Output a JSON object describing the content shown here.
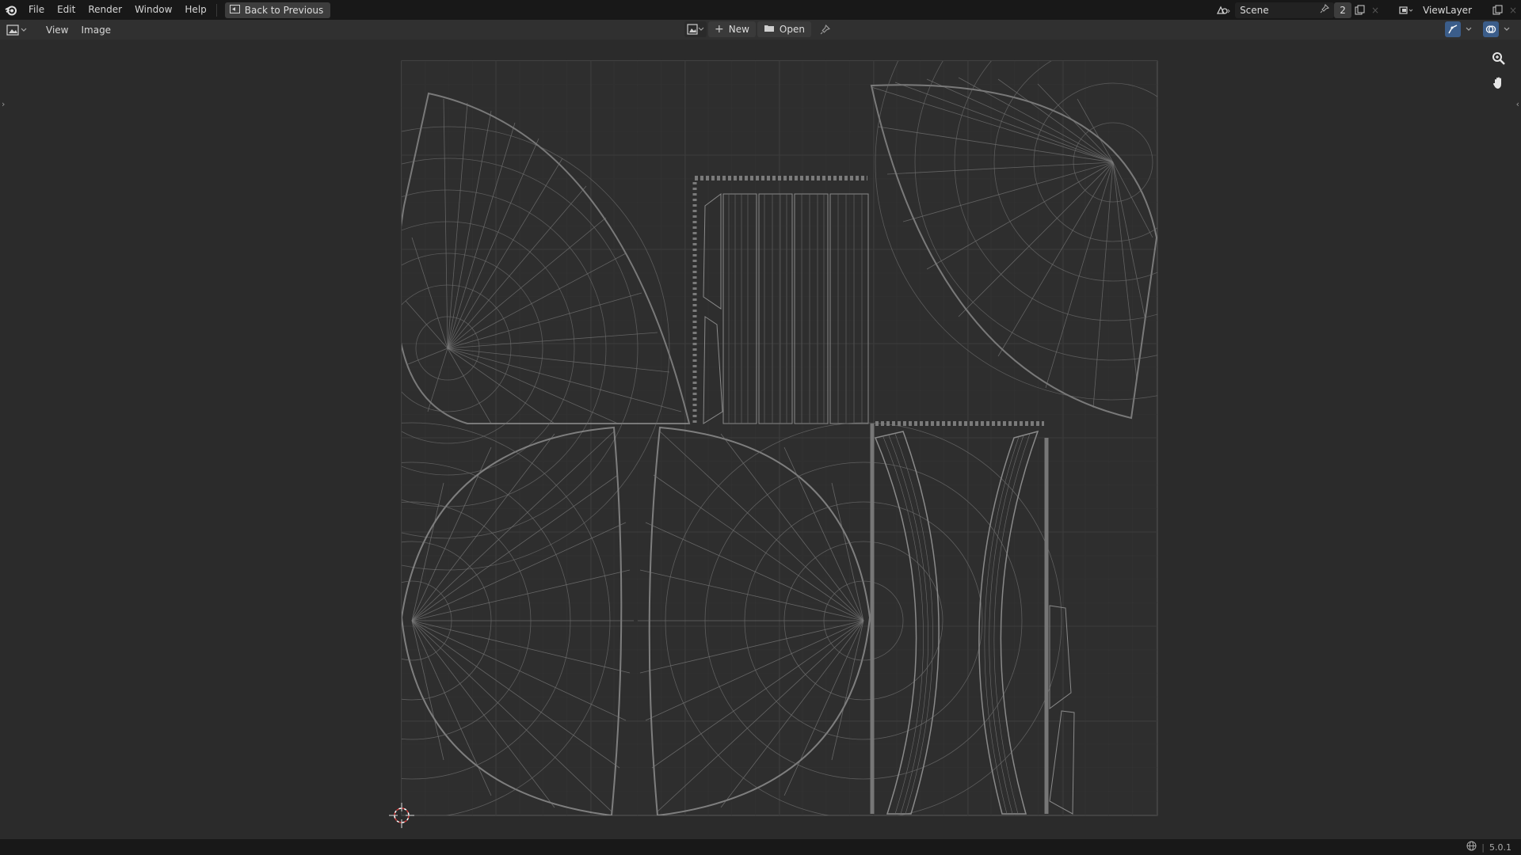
{
  "topbar": {
    "menus": [
      "File",
      "Edit",
      "Render",
      "Window",
      "Help"
    ],
    "back_label": "Back to Previous",
    "scene_name": "Scene",
    "scene_users": "2",
    "view_layer": "ViewLayer"
  },
  "header": {
    "menus": [
      "View",
      "Image"
    ],
    "new_label": "New",
    "open_label": "Open"
  },
  "status": {
    "version": "5.0.1"
  },
  "colors": {
    "background": "#2b2b2b",
    "topbar": "#181818",
    "header": "#303030",
    "grid_minor": "#3a3a3a",
    "grid_major": "#444444",
    "uv_wire": "#8a8a8a",
    "cursor": "#d23c3c"
  },
  "icons": [
    "blender-logo-icon",
    "back-icon",
    "scene-icon",
    "pin-icon",
    "new-scene-icon",
    "close-icon",
    "view-layer-icon",
    "image-editor-icon",
    "image-browse-icon",
    "plus-icon",
    "folder-icon",
    "uv-sync-icon",
    "overlay-icon",
    "zoom-icon",
    "hand-icon",
    "globe-icon",
    "cursor-2d-icon"
  ]
}
